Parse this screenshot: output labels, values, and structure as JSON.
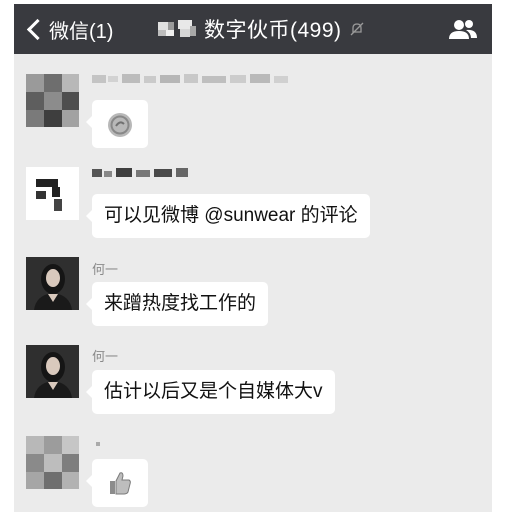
{
  "header": {
    "back_label": "微信(1)",
    "title": "数字伙币(499)",
    "mute_icon": "mute-bell-icon",
    "group_icon": "group-members-icon"
  },
  "messages": [
    {
      "sender": "",
      "type": "sticker",
      "content": "",
      "sticker_icon": "coin-sticker-icon"
    },
    {
      "sender": "",
      "type": "text",
      "content": "可以见微博 @sunwear 的评论"
    },
    {
      "sender": "何一",
      "type": "text",
      "content": "来蹭热度找工作的"
    },
    {
      "sender": "何一",
      "type": "text",
      "content": "估计以后又是个自媒体大v"
    },
    {
      "sender": "",
      "type": "sticker",
      "content": "",
      "sticker_icon": "thumbs-up-icon"
    }
  ],
  "colors": {
    "header_bg": "#393a3f",
    "chat_bg": "#ebebeb",
    "bubble_bg": "#ffffff"
  }
}
